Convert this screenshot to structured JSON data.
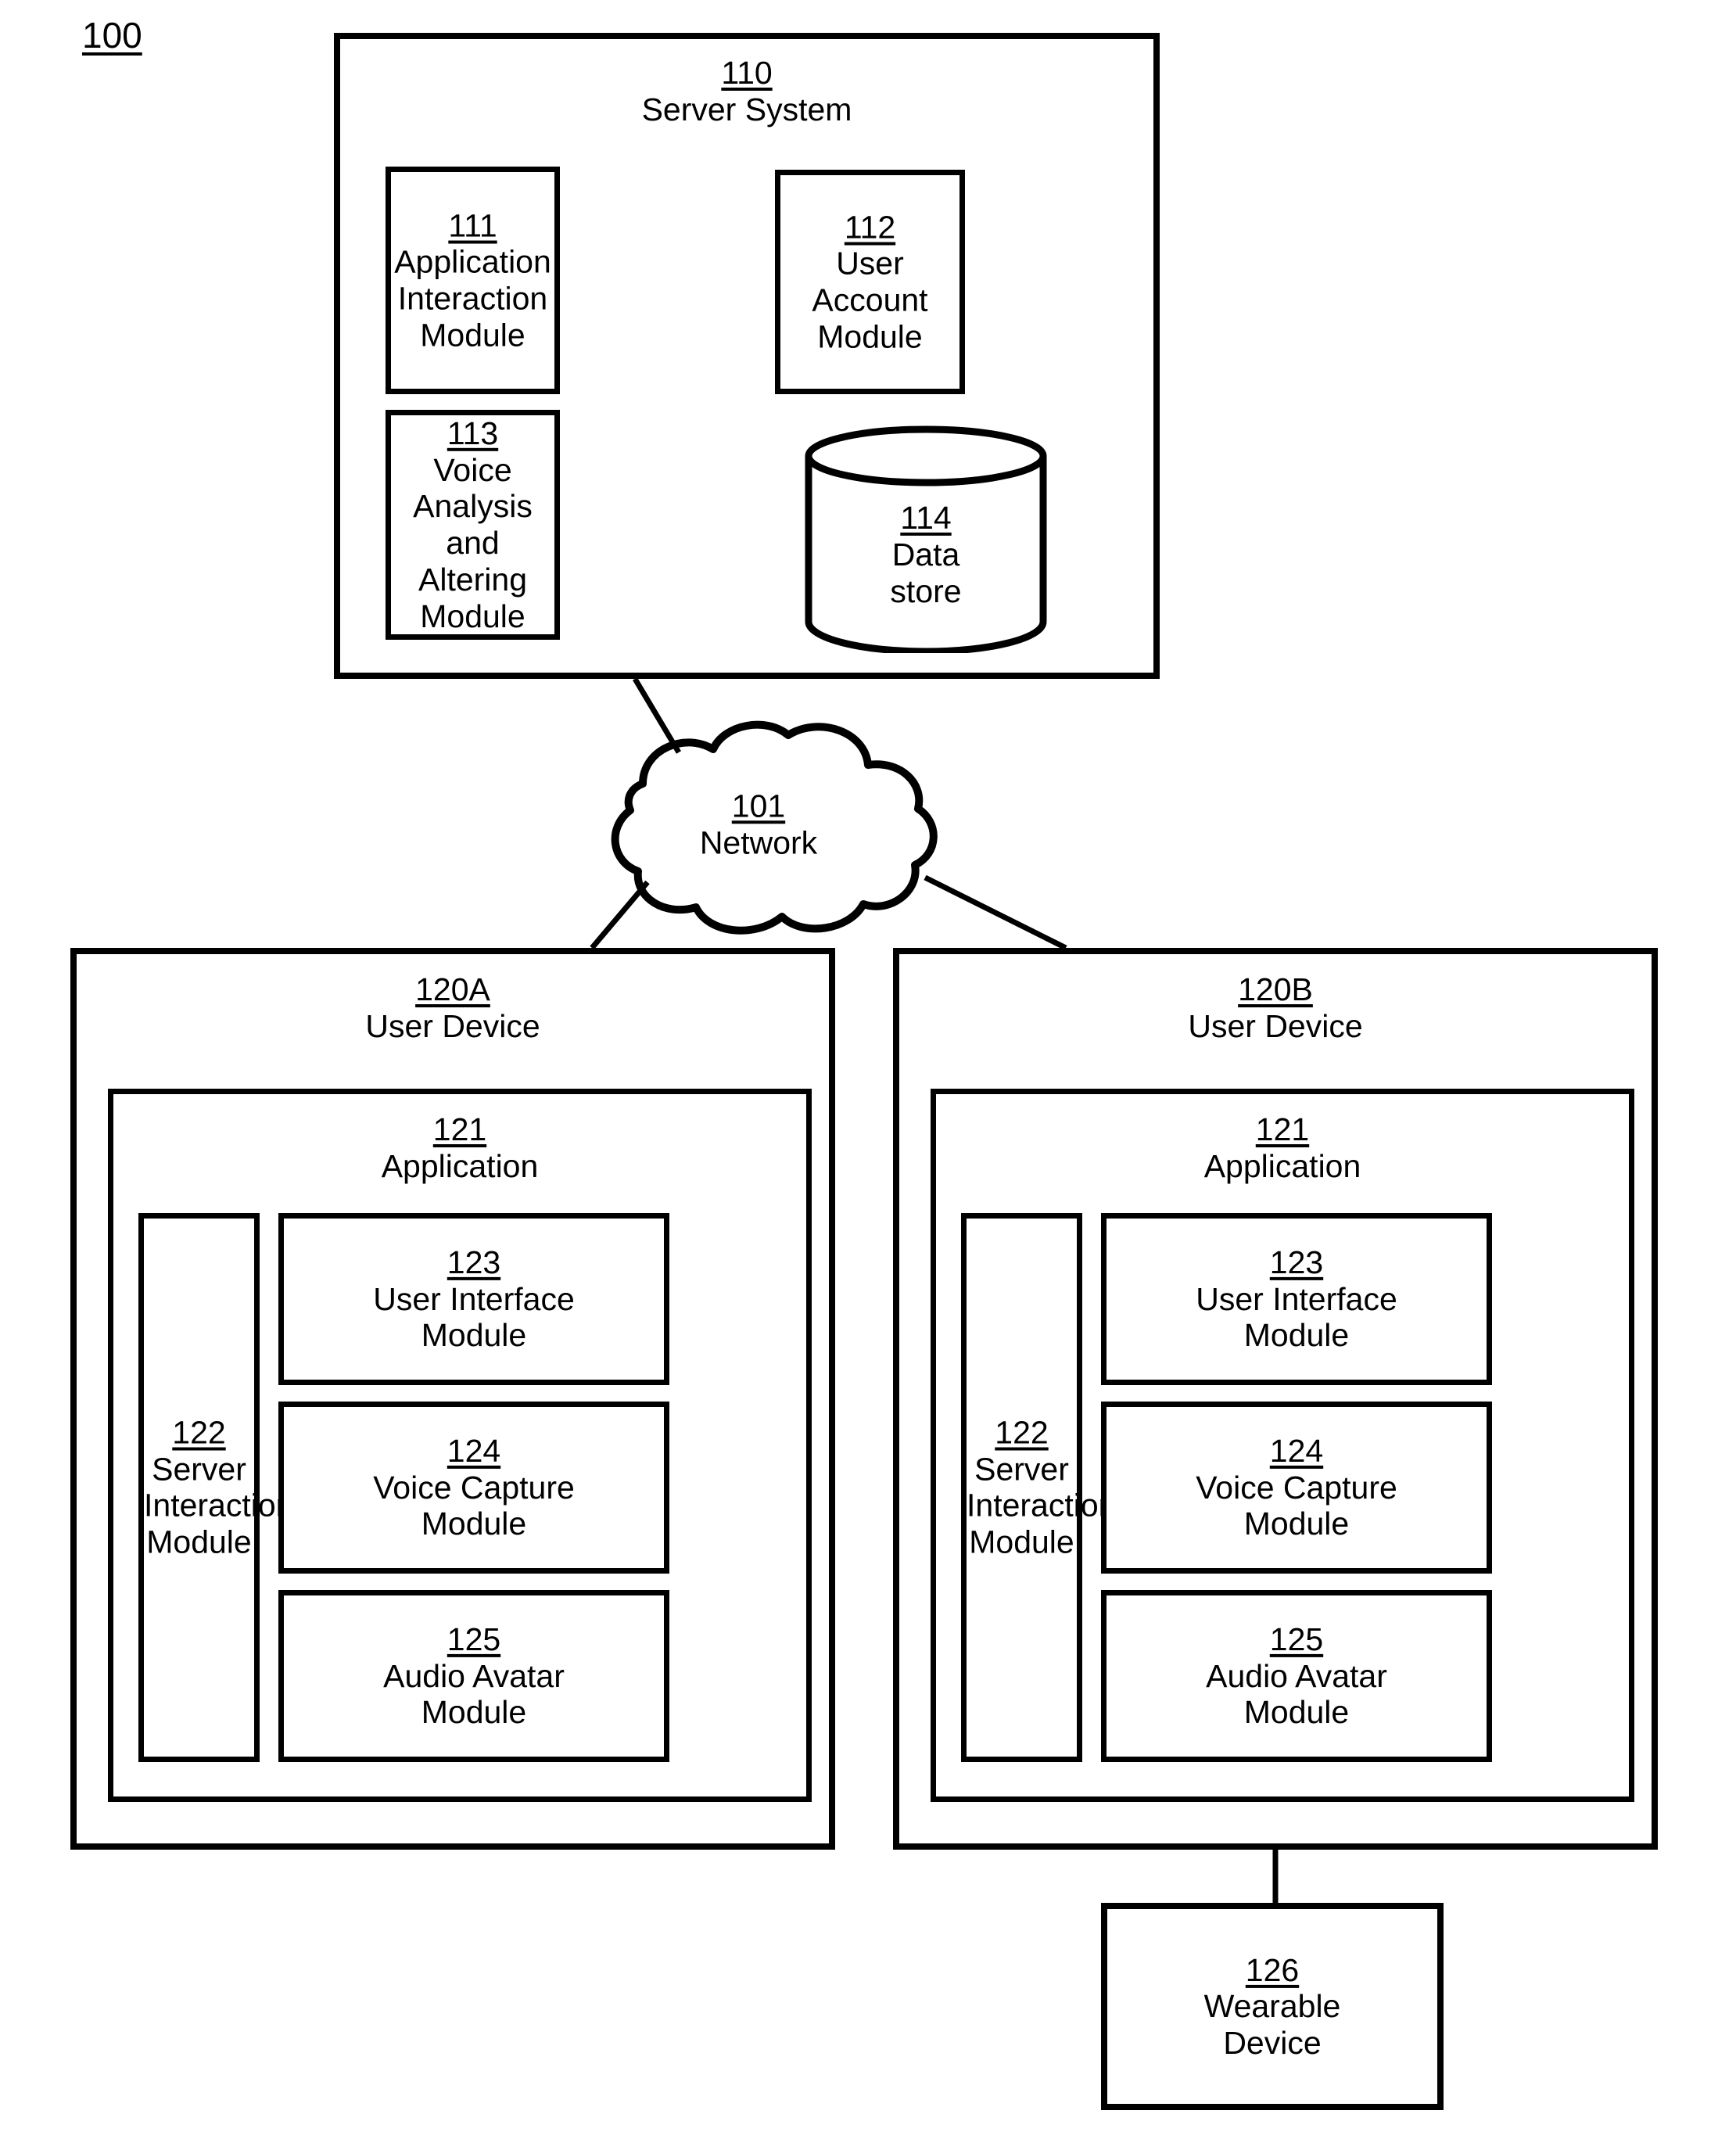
{
  "figure": {
    "ref": "100"
  },
  "server_system": {
    "ref": "110",
    "title": "Server System",
    "modules": [
      {
        "ref": "111",
        "title": "Application\nInteraction\nModule"
      },
      {
        "ref": "112",
        "title": "User Account\nModule"
      },
      {
        "ref": "113",
        "title": "Voice Analysis\nand Altering\nModule"
      },
      {
        "ref": "114",
        "title": "Data\nstore",
        "shape": "cylinder"
      }
    ]
  },
  "network": {
    "ref": "101",
    "title": "Network"
  },
  "devices": [
    {
      "ref": "120A",
      "title": "User Device",
      "application": {
        "ref": "121",
        "title": "Application",
        "left_module": {
          "ref": "122",
          "title": "Server\nInteraction\nModule"
        },
        "right_modules": [
          {
            "ref": "123",
            "title": "User Interface\nModule"
          },
          {
            "ref": "124",
            "title": "Voice Capture\nModule"
          },
          {
            "ref": "125",
            "title": "Audio Avatar\nModule"
          }
        ]
      }
    },
    {
      "ref": "120B",
      "title": "User Device",
      "application": {
        "ref": "121",
        "title": "Application",
        "left_module": {
          "ref": "122",
          "title": "Server\nInteraction\nModule"
        },
        "right_modules": [
          {
            "ref": "123",
            "title": "User Interface\nModule"
          },
          {
            "ref": "124",
            "title": "Voice Capture\nModule"
          },
          {
            "ref": "125",
            "title": "Audio Avatar\nModule"
          }
        ]
      }
    }
  ],
  "wearable": {
    "ref": "126",
    "title": "Wearable\nDevice"
  },
  "colors": {
    "stroke": "#000000",
    "background": "#ffffff"
  }
}
